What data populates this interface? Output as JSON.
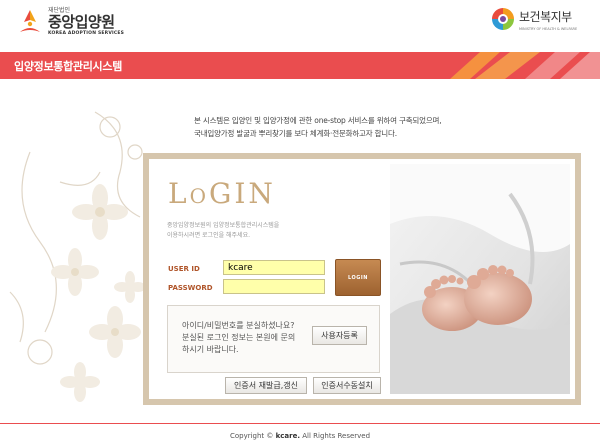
{
  "header": {
    "org_small": "재단법인",
    "org_name": "중앙입양원",
    "org_en": "KOREA ADOPTION SERVICES",
    "ministry_name": "보건복지부",
    "ministry_en": "MINISTRY OF HEALTH & WELFARE"
  },
  "titlebar": {
    "label": "입양정보통합관리시스템"
  },
  "intro": {
    "line1": "본 시스템은 입양인 및 입양가정에 관한 one-stop 서비스를 위하여 구축되었으며,",
    "line2": "국내입양가정 발굴과 뿌리찾기를 보다 체계화·전문화하고자 합니다."
  },
  "login": {
    "title": "LoGIN",
    "desc_line1": "중앙입양정보원의 입양정보통합관리시스템을",
    "desc_line2": "이용하시려면 로그인을 해주세요.",
    "userid_label": "USER ID",
    "password_label": "PASSWORD",
    "userid_value": "kcare",
    "password_value": "",
    "login_button": "LOGIN",
    "lost_line1": "아이디/비밀번호를 분실하셨나요?",
    "lost_line2": "분실된 로그인 정보는 본원에 문의",
    "lost_line3": "하시기 바랍니다.",
    "register_button": "사용자등록",
    "cert_renew_button": "인증서 재발급,갱신",
    "cert_install_button": "인증서수동설치"
  },
  "footer": {
    "prefix": "Copyright ©",
    "brand": "kcare.",
    "suffix": "All Rights Reserved"
  },
  "colors": {
    "titlebar": "#ea4d4f",
    "login_frame": "#d6c6ad",
    "input_bg": "#ffffaa",
    "login_button": "#b5783f",
    "label": "#b0552a"
  }
}
